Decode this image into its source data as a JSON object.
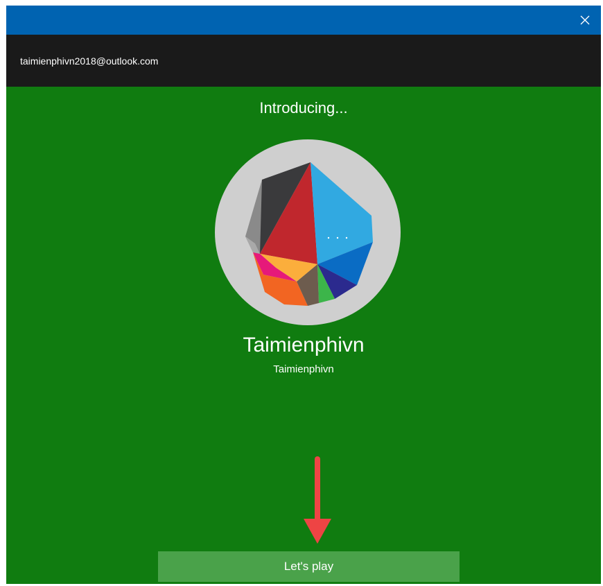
{
  "window": {
    "close_icon": "close-icon"
  },
  "account": {
    "email": "taimienphivn2018@outlook.com"
  },
  "main": {
    "intro_text": "Introducing...",
    "avatar_icon": "gamerpic-polygon-icon",
    "gamertag": "Taimienphivn",
    "real_name": "Taimienphivn",
    "arrow_icon": "arrow-down-icon"
  },
  "actions": {
    "lets_play_label": "Let's play"
  },
  "colors": {
    "titlebar": "#0063b1",
    "account_bar": "#1a1a1a",
    "background": "#107c10",
    "button": "#4aa24a",
    "arrow": "#ee4444"
  }
}
